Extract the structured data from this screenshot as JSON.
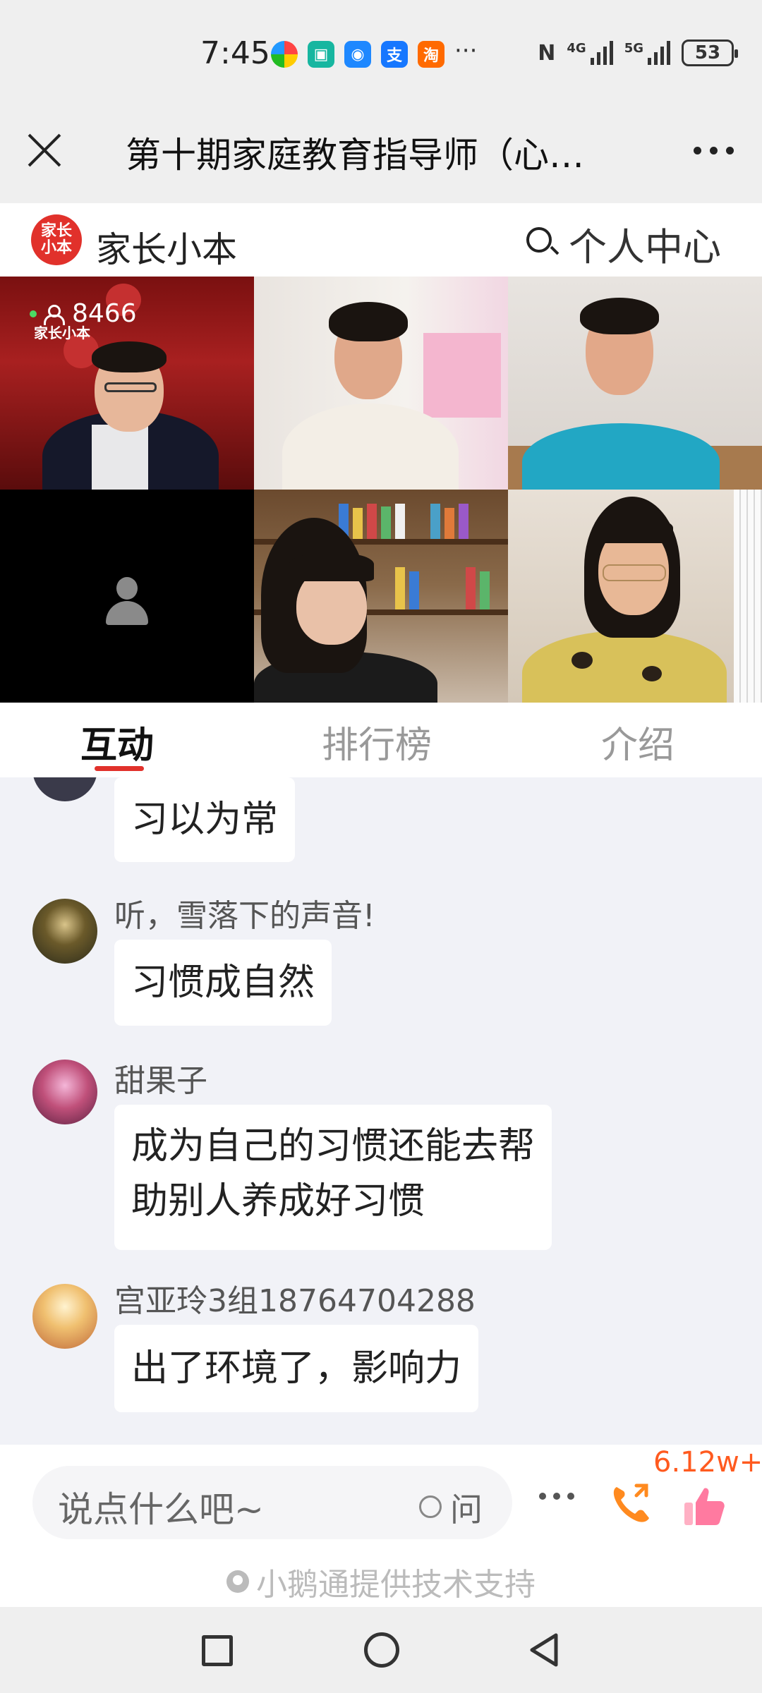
{
  "status_bar": {
    "time": "7:45",
    "dots": "···",
    "nfc": "N",
    "network1": "4G",
    "network2": "5G",
    "battery": "53"
  },
  "title_bar": {
    "title": "第十期家庭教育指导师（心…",
    "more_label": "more"
  },
  "brand": {
    "logo_line1": "家长",
    "logo_line2": "小本",
    "name": "家长小本",
    "user_center": "个人中心"
  },
  "video": {
    "viewer_count": "8466",
    "tile_logo": "家长小本"
  },
  "tabs": [
    {
      "label": "互动",
      "active": true
    },
    {
      "label": "排行榜",
      "active": false
    },
    {
      "label": "介绍",
      "active": false
    }
  ],
  "messages": [
    {
      "name": "",
      "text": "习以为常"
    },
    {
      "name": "听，雪落下的声音!",
      "text": "习惯成自然"
    },
    {
      "name": "甜果子",
      "text_line1": "成为自己的习惯还能去帮",
      "text_line2": "助别人养成好习惯"
    },
    {
      "name": "宫亚玲3组18764704288",
      "text": "出了环境了，影响力"
    }
  ],
  "bottom": {
    "input_placeholder": "说点什么吧~",
    "ask_label": "问",
    "like_count": "6.12w+",
    "tech_support": "小鹅通提供技术支持"
  },
  "colors": {
    "accent": "#e1312b",
    "like": "#ff5a1f",
    "chat_bg": "#f1f2f7"
  }
}
